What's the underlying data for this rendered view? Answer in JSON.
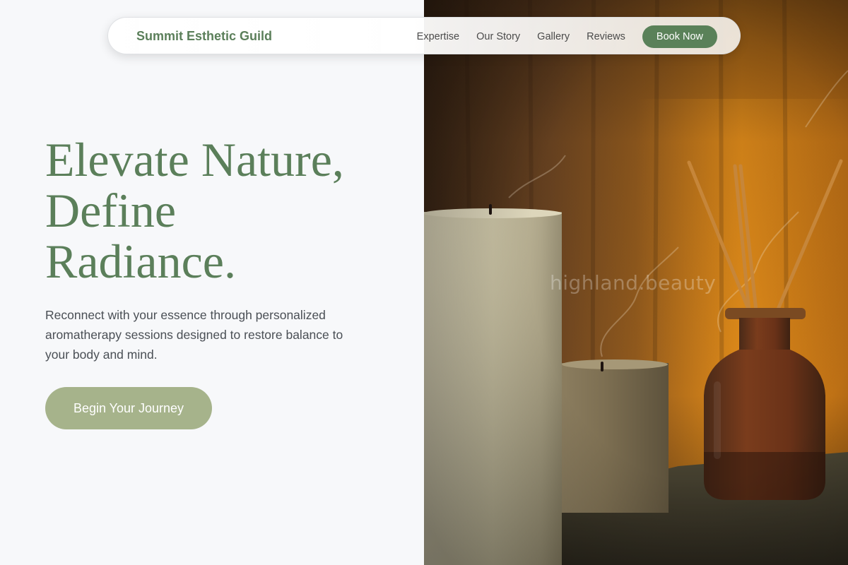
{
  "nav": {
    "brand": "Summit Esthetic Guild",
    "links": [
      "Expertise",
      "Our Story",
      "Gallery",
      "Reviews"
    ],
    "cta": "Book Now"
  },
  "hero": {
    "headline": [
      "Elevate Nature,",
      "Define",
      "Radiance."
    ],
    "subtext": "Reconnect with your essence through personalized aromatherapy sessions designed to restore balance to your body and mind.",
    "cta": "Begin Your Journey",
    "image_watermark": "highland.beauty"
  },
  "colors": {
    "brand_green": "#5b7f5a",
    "button_green": "#5a8159",
    "cta_sage": "#a6b38b",
    "background": "#f7f8fa",
    "body_text": "#4a4f55"
  }
}
